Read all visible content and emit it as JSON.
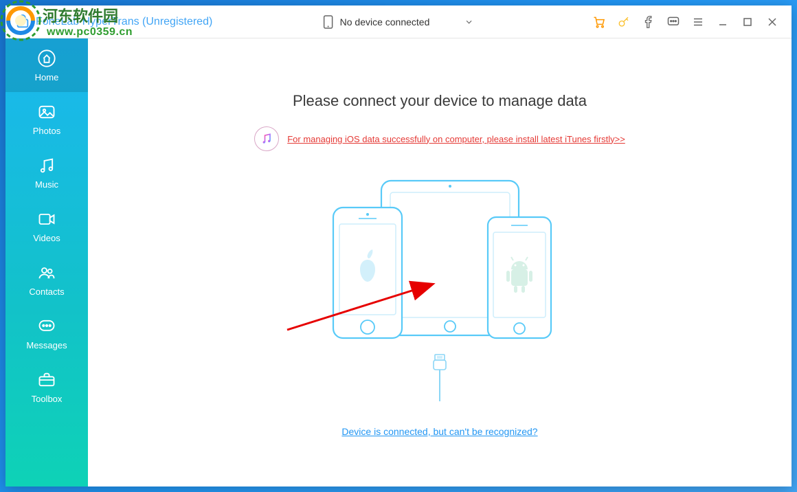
{
  "app": {
    "title": "FoneLab HyperTrans (Unregistered)"
  },
  "watermark": {
    "line1": "河东软件园",
    "line2": "www.pc0359.cn"
  },
  "titlebar": {
    "device_selector": "No device connected",
    "icons": {
      "phone": "phone-icon",
      "chevron": "chevron-down-icon",
      "cart": "cart-icon",
      "key": "key-icon",
      "facebook": "facebook-icon",
      "chat": "chat-icon",
      "menu": "menu-icon",
      "minimize": "minimize-icon",
      "maximize": "maximize-icon",
      "close": "close-icon"
    }
  },
  "sidebar": {
    "items": [
      {
        "label": "Home",
        "icon": "home-icon",
        "active": true
      },
      {
        "label": "Photos",
        "icon": "photos-icon",
        "active": false
      },
      {
        "label": "Music",
        "icon": "music-icon",
        "active": false
      },
      {
        "label": "Videos",
        "icon": "videos-icon",
        "active": false
      },
      {
        "label": "Contacts",
        "icon": "contacts-icon",
        "active": false
      },
      {
        "label": "Messages",
        "icon": "messages-icon",
        "active": false
      },
      {
        "label": "Toolbox",
        "icon": "toolbox-icon",
        "active": false
      }
    ]
  },
  "main": {
    "heading": "Please connect your device to manage data",
    "itunes_notice": "For managing iOS data successfully on computer, please install latest iTunes firstly>>",
    "help_link": "Device is connected, but can't be recognized?"
  },
  "colors": {
    "accent_blue": "#42a5f5",
    "device_outline": "#58caf8",
    "sidebar_top": "#1bb7f0",
    "sidebar_bottom": "#0ed2b6",
    "notice_red": "#e53935",
    "link_blue": "#2196f3",
    "watermark_green": "#2f9d2f"
  },
  "annotation": {
    "type": "red-arrow",
    "points_to": "iphone-device"
  }
}
